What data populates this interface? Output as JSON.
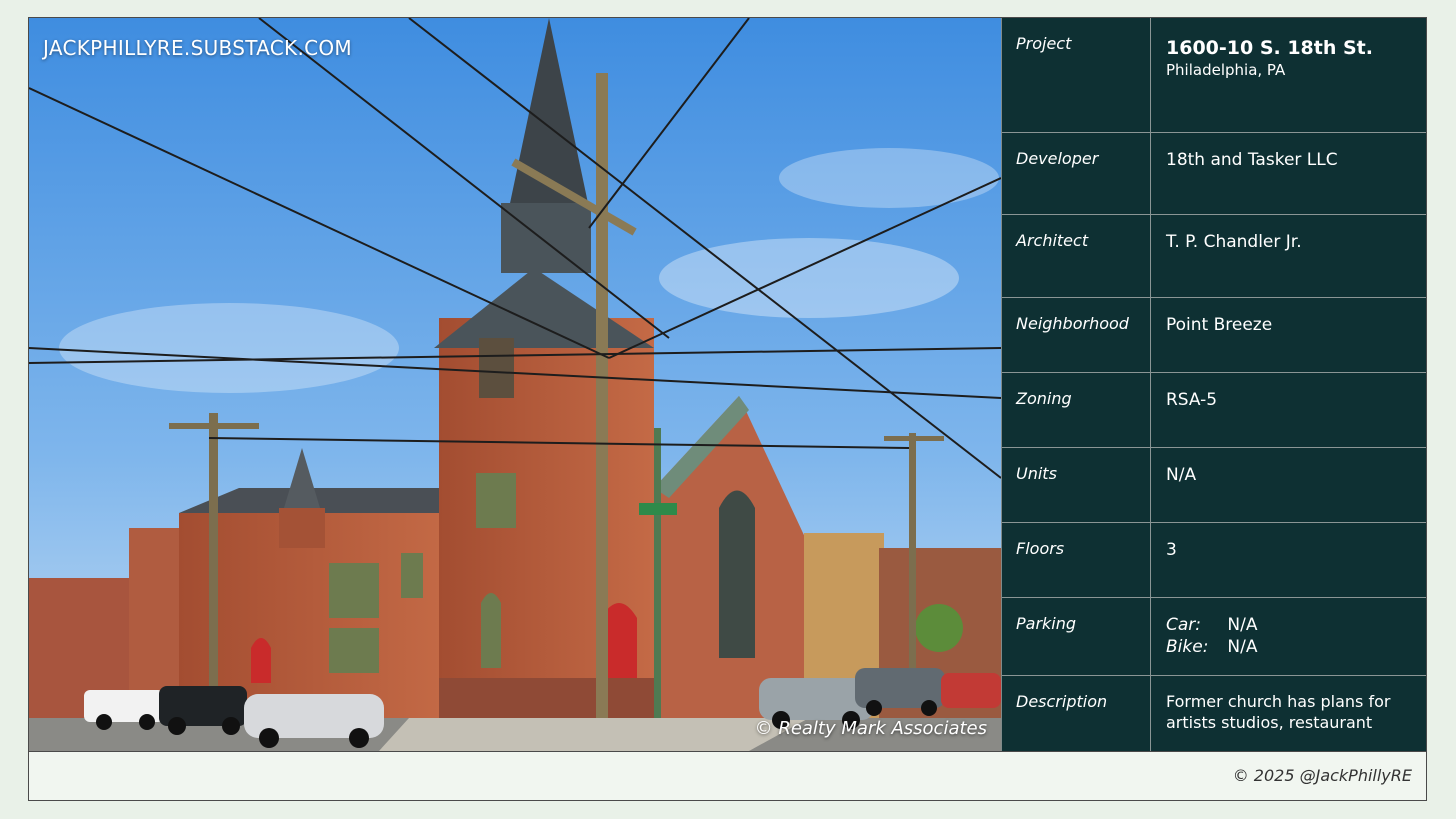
{
  "photo": {
    "watermark_top": "JACKPHILLYRE.SUBSTACK.COM",
    "watermark_bottom": "© Realty Mark Associates",
    "description_icon": "church-photo"
  },
  "info": {
    "project_label": "Project",
    "project_value": "1600-10 S. 18th St.",
    "project_city": "Philadelphia, PA",
    "developer_label": "Developer",
    "developer_value": "18th and Tasker LLC",
    "architect_label": "Architect",
    "architect_value": "T. P. Chandler Jr.",
    "neighborhood_label": "Neighborhood",
    "neighborhood_value": "Point Breeze",
    "zoning_label": "Zoning",
    "zoning_value": "RSA-5",
    "units_label": "Units",
    "units_value": "N/A",
    "floors_label": "Floors",
    "floors_value": "3",
    "parking_label": "Parking",
    "parking_car_key": "Car:",
    "parking_car_value": "N/A",
    "parking_bike_key": "Bike:",
    "parking_bike_value": "N/A",
    "description_label": "Description",
    "description_value": "Former church has plans for artists studios, restaurant"
  },
  "footer": {
    "credit": "© 2025 @JackPhillyRE"
  },
  "colors": {
    "panel": "#0e3033",
    "page": "#e9f1e8",
    "brick": "#b4583a"
  }
}
